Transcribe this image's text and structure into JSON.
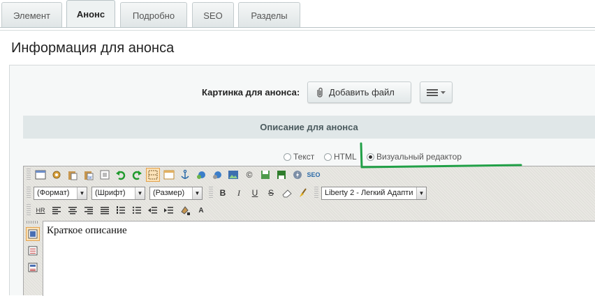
{
  "tabs": [
    {
      "label": "Элемент",
      "active": false
    },
    {
      "label": "Анонс",
      "active": true
    },
    {
      "label": "Подробно",
      "active": false
    },
    {
      "label": "SEO",
      "active": false
    },
    {
      "label": "Разделы",
      "active": false
    }
  ],
  "section": {
    "title": "Информация для анонса",
    "picture_label": "Картинка для анонса:",
    "add_file_label": "Добавить файл",
    "description_header": "Описание для анонса"
  },
  "editor_mode": {
    "options": [
      "Текст",
      "HTML",
      "Визуальный редактор"
    ],
    "selected": "Визуальный редактор"
  },
  "toolbar": {
    "format_select": "(Формат)",
    "font_select": "(Шрифт)",
    "size_select": "(Размер)",
    "template_select": "Liberty 2 - Легкий Адапти",
    "bold": "B",
    "italic": "I",
    "underline": "U",
    "strike": "S",
    "hr": "HR",
    "seo": "SEO",
    "copyright": "©"
  },
  "editor": {
    "content": "Краткое описание"
  },
  "colors": {
    "accent_highlight": "#21a047",
    "selected_tool_bg": "#fbe2b8"
  }
}
